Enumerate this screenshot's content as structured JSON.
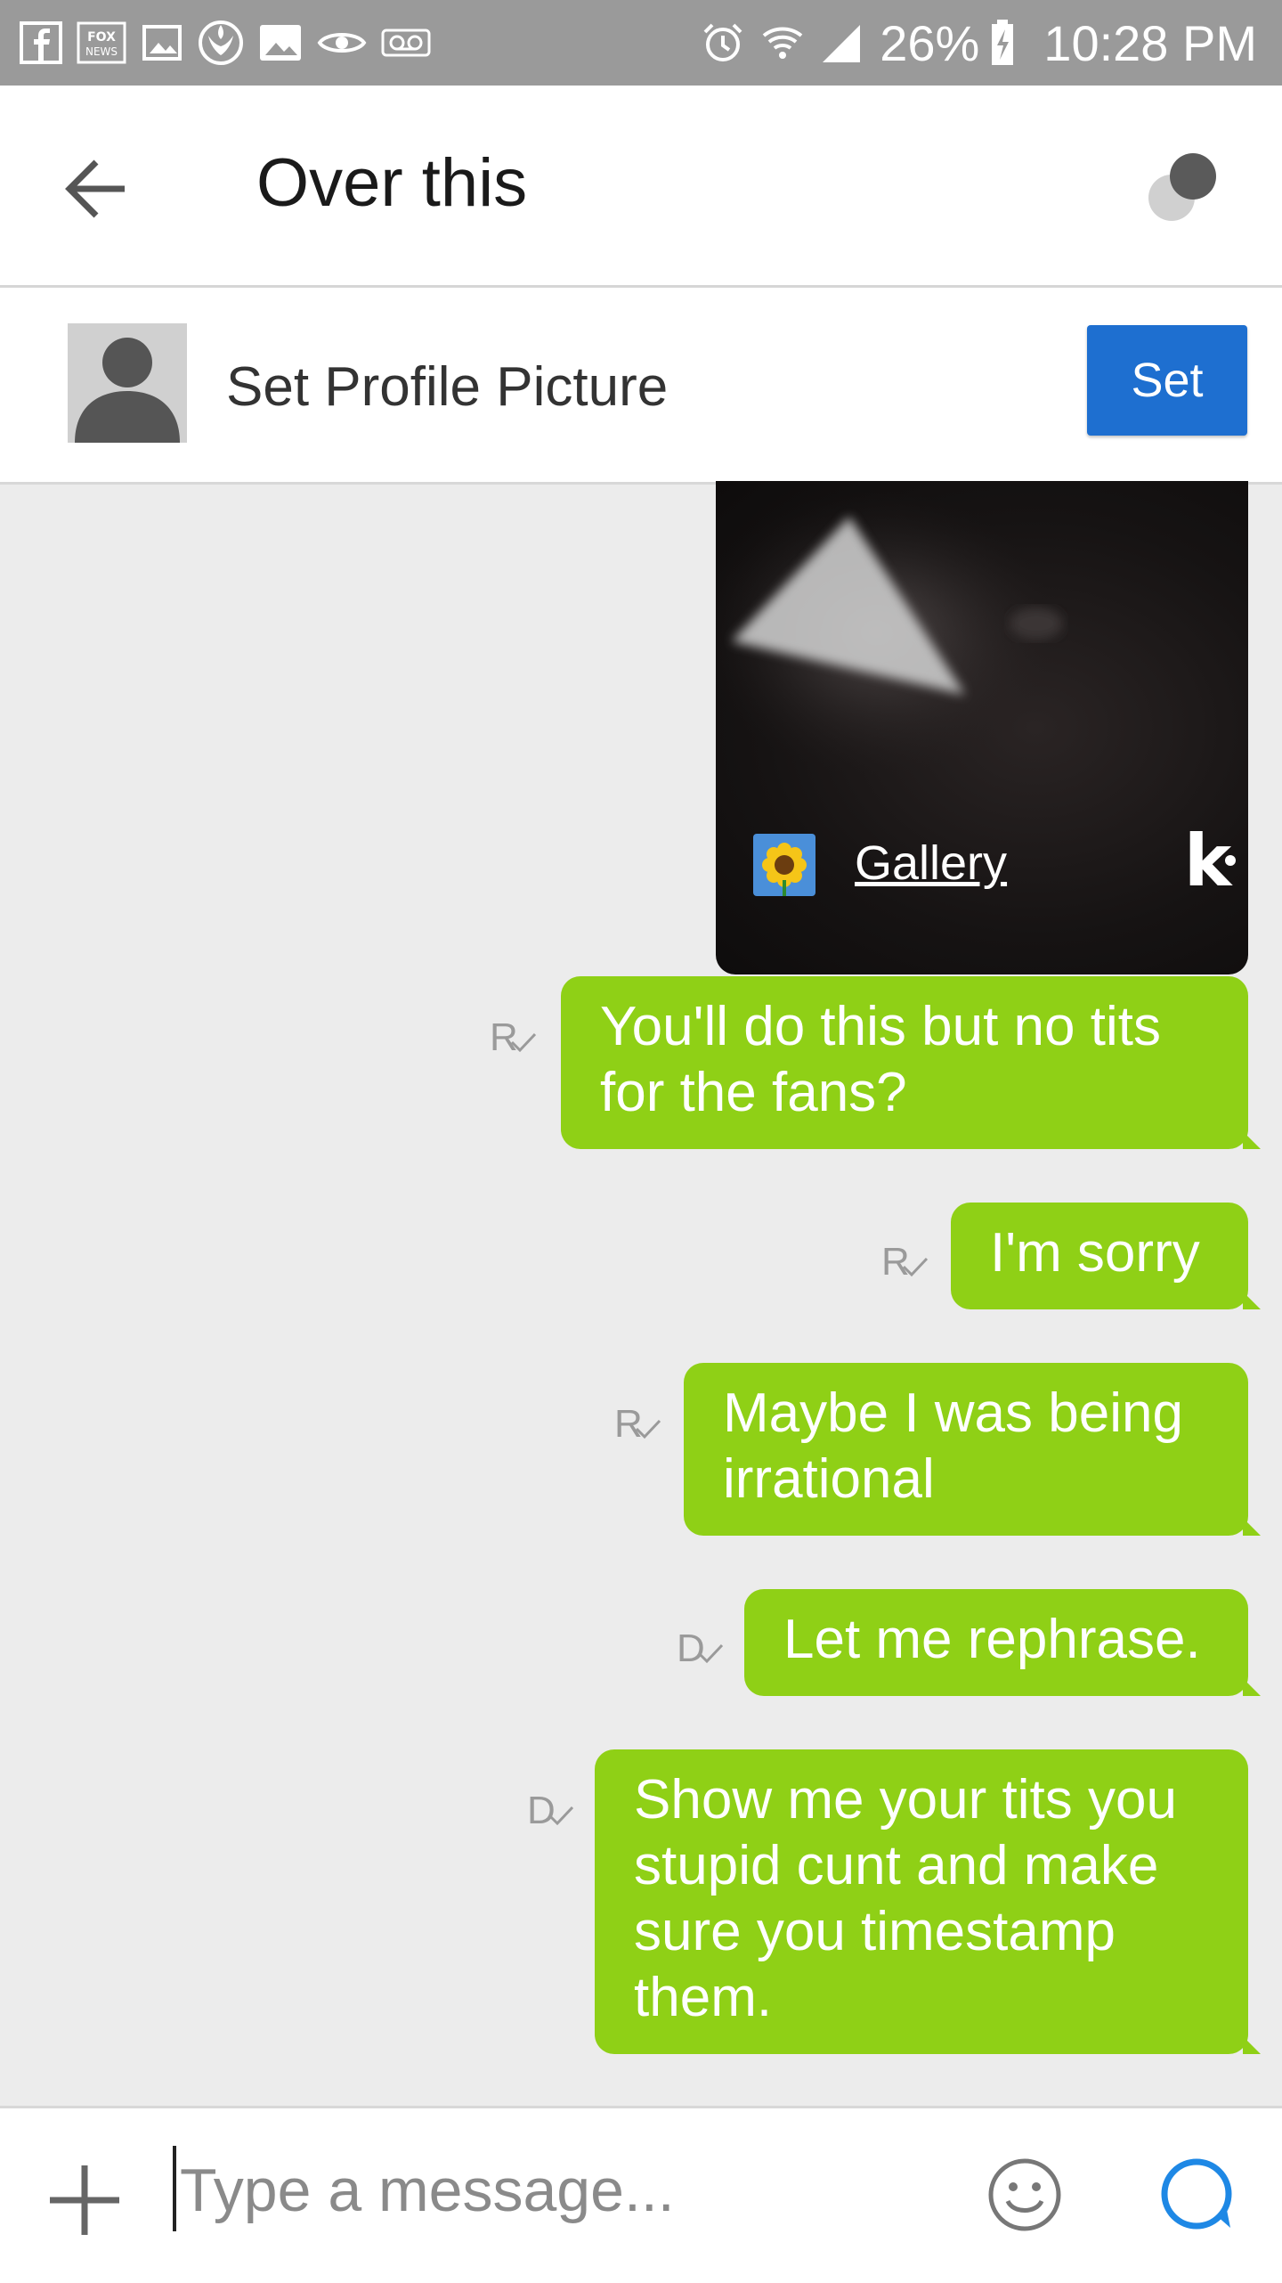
{
  "status_bar": {
    "battery": "26%",
    "time": "10:28 PM",
    "notification_icons": [
      "facebook-icon",
      "fox-news-icon",
      "gallery-icon",
      "rebel-alliance-icon",
      "image-icon",
      "eye-icon",
      "voicemail-icon"
    ],
    "status_icons": [
      "alarm-icon",
      "wifi-icon",
      "signal-icon",
      "battery-charging-icon"
    ]
  },
  "header": {
    "title": "Over this"
  },
  "profile_banner": {
    "text": "Set Profile Picture",
    "button_label": "Set"
  },
  "media_card": {
    "label": "Gallery",
    "brand": "k"
  },
  "messages": [
    {
      "lines": [
        "You'll do this but no tits",
        "for the fans?"
      ],
      "receipt": "R"
    },
    {
      "lines": [
        "I'm sorry"
      ],
      "receipt": "R"
    },
    {
      "lines": [
        "Maybe I was being",
        "irrational"
      ],
      "receipt": "R"
    },
    {
      "lines": [
        "Let me rephrase."
      ],
      "receipt": "D"
    },
    {
      "lines": [
        "Show me your tits you",
        "stupid cunt and make",
        "sure you timestamp",
        "them."
      ],
      "receipt": "D"
    }
  ],
  "composer": {
    "placeholder": "Type a message..."
  },
  "colors": {
    "bubble": "#8fd016",
    "set_button": "#1e6fd0",
    "status_bar": "#9a9a9a",
    "send_icon": "#1e88e5"
  }
}
